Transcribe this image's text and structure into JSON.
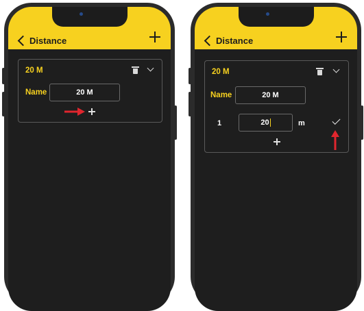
{
  "left_screen": {
    "header": {
      "back_label": "Distance"
    },
    "card": {
      "title": "20 M",
      "name_label": "Name",
      "name_value": "20 M"
    }
  },
  "right_screen": {
    "header": {
      "back_label": "Distance"
    },
    "card": {
      "title": "20 M",
      "name_label": "Name",
      "name_value": "20 M",
      "row": {
        "index": "1",
        "value": "20",
        "unit": "m"
      }
    }
  },
  "colors": {
    "accent": "#f7d11f",
    "background": "#1e1e1e",
    "arrow": "#e0262e"
  },
  "icons": [
    "back-chevron-icon",
    "plus-icon",
    "trash-icon",
    "chevron-down-icon",
    "check-icon",
    "arrow-right-icon",
    "arrow-up-icon"
  ]
}
